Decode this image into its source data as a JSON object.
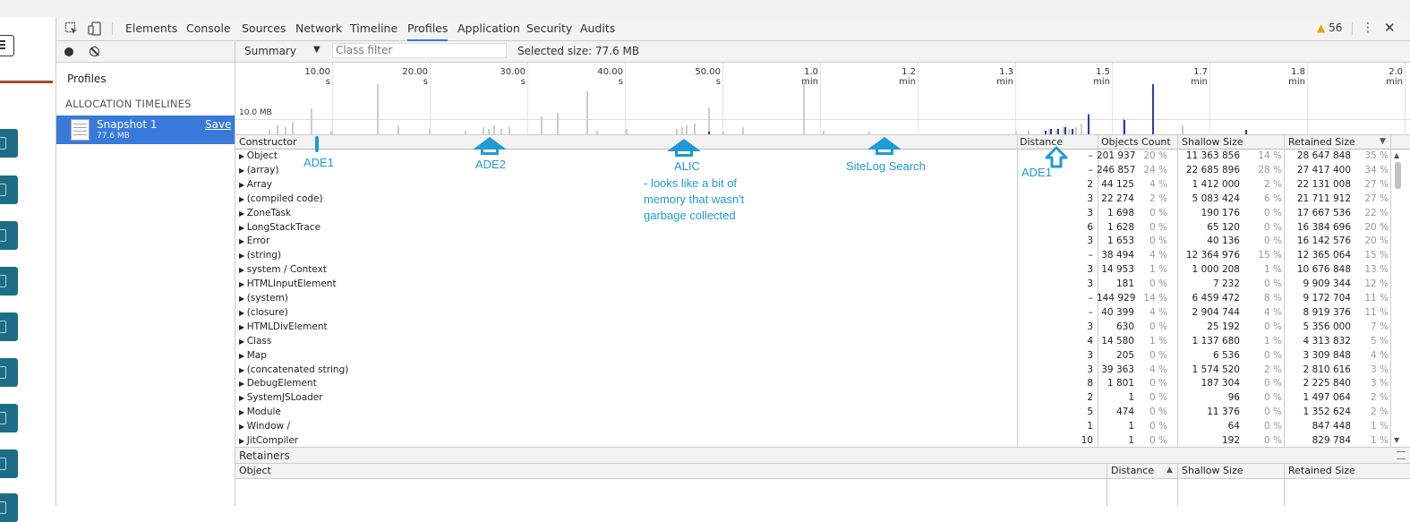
{
  "devtools": {
    "tabs": [
      "Elements",
      "Console",
      "Sources",
      "Network",
      "Timeline",
      "Profiles",
      "Application",
      "Security",
      "Audits"
    ],
    "selected_tab": "Profiles",
    "warning_count": "56"
  },
  "sidebar": {
    "title": "Profiles",
    "section": "ALLOCATION TIMELINES",
    "snapshot": {
      "name": "Snapshot 1",
      "size": "77.6 MB",
      "save": "Save"
    }
  },
  "toolbar": {
    "view": "Summary",
    "class_filter_placeholder": "Class filter",
    "selected_size": "Selected size: 77.6 MB"
  },
  "overview": {
    "ticks": [
      "10.00 s",
      "20.00 s",
      "30.00 s",
      "40.00 s",
      "50.00 s",
      "1.0 min",
      "1.2 min",
      "1.3 min",
      "1.5 min",
      "1.7 min",
      "1.8 min",
      "2.0 min"
    ],
    "scale_label": "10.0 MB"
  },
  "table": {
    "columns": {
      "constructor": "Constructor",
      "distance": "Distance",
      "objects_count": "Objects Count",
      "shallow_size": "Shallow Size",
      "retained_size": "Retained Size",
      "sort_indicator": "▼"
    },
    "rows": [
      {
        "name": "Object",
        "dist": "–",
        "cnt": "201 937",
        "cntp": "20 %",
        "sh": "11 363 856",
        "shp": "14 %",
        "ret": "28 647 848",
        "retp": "35 %"
      },
      {
        "name": "(array)",
        "dist": "–",
        "cnt": "246 857",
        "cntp": "24 %",
        "sh": "22 685 896",
        "shp": "28 %",
        "ret": "27 417 400",
        "retp": "34 %"
      },
      {
        "name": "Array",
        "dist": "2",
        "cnt": "44 125",
        "cntp": "4 %",
        "sh": "1 412 000",
        "shp": "2 %",
        "ret": "22 131 008",
        "retp": "27 %"
      },
      {
        "name": "(compiled code)",
        "dist": "3",
        "cnt": "22 274",
        "cntp": "2 %",
        "sh": "5 083 424",
        "shp": "6 %",
        "ret": "21 711 912",
        "retp": "27 %"
      },
      {
        "name": "ZoneTask",
        "dist": "3",
        "cnt": "1 698",
        "cntp": "0 %",
        "sh": "190 176",
        "shp": "0 %",
        "ret": "17 667 536",
        "retp": "22 %"
      },
      {
        "name": "LongStackTrace",
        "dist": "6",
        "cnt": "1 628",
        "cntp": "0 %",
        "sh": "65 120",
        "shp": "0 %",
        "ret": "16 384 696",
        "retp": "20 %"
      },
      {
        "name": "Error",
        "dist": "3",
        "cnt": "1 653",
        "cntp": "0 %",
        "sh": "40 136",
        "shp": "0 %",
        "ret": "16 142 576",
        "retp": "20 %"
      },
      {
        "name": "(string)",
        "dist": "–",
        "cnt": "38 494",
        "cntp": "4 %",
        "sh": "12 364 976",
        "shp": "15 %",
        "ret": "12 365 064",
        "retp": "15 %"
      },
      {
        "name": "system / Context",
        "dist": "3",
        "cnt": "14 953",
        "cntp": "1 %",
        "sh": "1 000 208",
        "shp": "1 %",
        "ret": "10 676 848",
        "retp": "13 %"
      },
      {
        "name": "HTMLInputElement",
        "dist": "3",
        "cnt": "181",
        "cntp": "0 %",
        "sh": "7 232",
        "shp": "0 %",
        "ret": "9 909 344",
        "retp": "12 %"
      },
      {
        "name": "(system)",
        "dist": "–",
        "cnt": "144 929",
        "cntp": "14 %",
        "sh": "6 459 472",
        "shp": "8 %",
        "ret": "9 172 704",
        "retp": "11 %"
      },
      {
        "name": "(closure)",
        "dist": "–",
        "cnt": "40 399",
        "cntp": "4 %",
        "sh": "2 904 744",
        "shp": "4 %",
        "ret": "8 919 376",
        "retp": "11 %"
      },
      {
        "name": "HTMLDivElement",
        "dist": "3",
        "cnt": "630",
        "cntp": "0 %",
        "sh": "25 192",
        "shp": "0 %",
        "ret": "5 356 000",
        "retp": "7 %"
      },
      {
        "name": "Class",
        "dist": "4",
        "cnt": "14 580",
        "cntp": "1 %",
        "sh": "1 137 680",
        "shp": "1 %",
        "ret": "4 313 832",
        "retp": "5 %"
      },
      {
        "name": "Map",
        "dist": "3",
        "cnt": "205",
        "cntp": "0 %",
        "sh": "6 536",
        "shp": "0 %",
        "ret": "3 309 848",
        "retp": "4 %"
      },
      {
        "name": "(concatenated string)",
        "dist": "3",
        "cnt": "39 363",
        "cntp": "4 %",
        "sh": "1 574 520",
        "shp": "2 %",
        "ret": "2 810 616",
        "retp": "3 %"
      },
      {
        "name": "DebugElement",
        "dist": "8",
        "cnt": "1 801",
        "cntp": "0 %",
        "sh": "187 304",
        "shp": "0 %",
        "ret": "2 225 840",
        "retp": "3 %"
      },
      {
        "name": "SystemJSLoader",
        "dist": "2",
        "cnt": "1",
        "cntp": "0 %",
        "sh": "96",
        "shp": "0 %",
        "ret": "1 497 064",
        "retp": "2 %"
      },
      {
        "name": "Module",
        "dist": "5",
        "cnt": "474",
        "cntp": "0 %",
        "sh": "11 376",
        "shp": "0 %",
        "ret": "1 352 624",
        "retp": "2 %"
      },
      {
        "name": "Window /",
        "dist": "1",
        "cnt": "1",
        "cntp": "0 %",
        "sh": "64",
        "shp": "0 %",
        "ret": "847 448",
        "retp": "1 %"
      },
      {
        "name": "JitCompiler",
        "dist": "10",
        "cnt": "1",
        "cntp": "0 %",
        "sh": "192",
        "shp": "0 %",
        "ret": "829 784",
        "retp": "1 %"
      }
    ]
  },
  "annotations": {
    "ade1_left": "ADE1",
    "ade2": "ADE2",
    "alic": "ALIC",
    "alic_note_1": "- looks like a bit of",
    "alic_note_2": "memory that wasn't",
    "alic_note_3": "garbage collected",
    "sitelog": "SiteLog Search",
    "ade1_right": "ADE1",
    "color": "#1e9ad6"
  },
  "retainers": {
    "title": "Retainers",
    "columns": {
      "object": "Object",
      "distance": "Distance",
      "sort_indicator": "▲",
      "shallow_size": "Shallow Size",
      "retained_size": "Retained Size"
    }
  }
}
